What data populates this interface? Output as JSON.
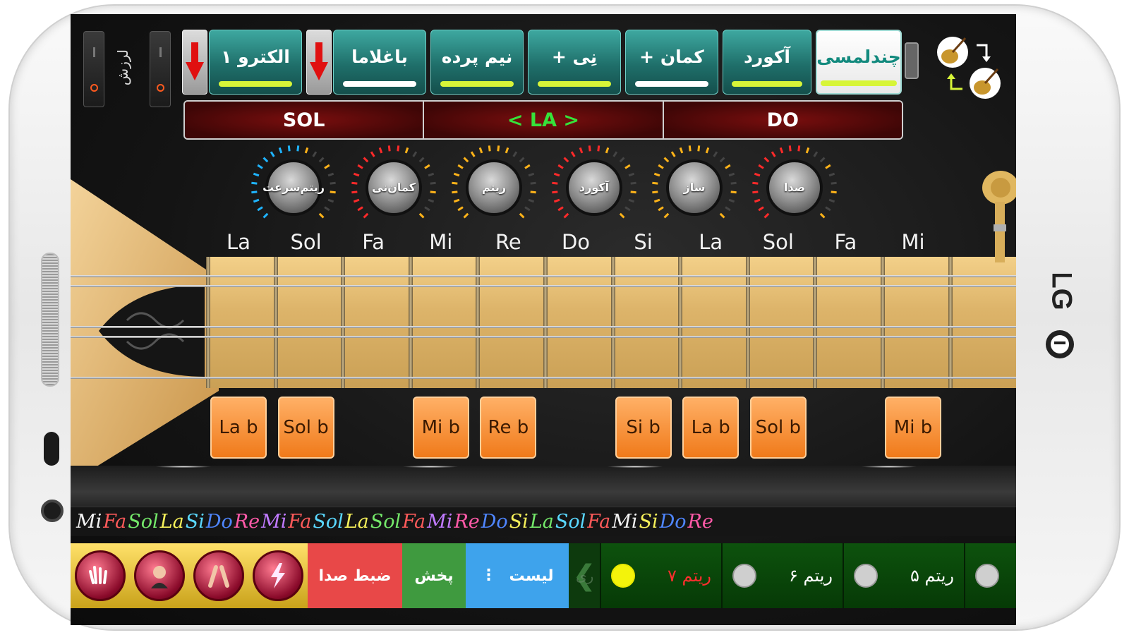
{
  "vibration_label": "لرزش",
  "tabs": [
    {
      "id": "electro",
      "label": "الکترو ۱",
      "bar": "#d7f538"
    },
    {
      "id": "baglama",
      "label": "باغلاما",
      "bar": "#ffffff"
    },
    {
      "id": "half-tone",
      "label": "نیم پرده",
      "bar": "#d7f538"
    },
    {
      "id": "ney",
      "label": "+ نِی",
      "bar": "#d7f538"
    },
    {
      "id": "kaman",
      "label": "+ کمان",
      "bar": "#ffffff"
    },
    {
      "id": "chord",
      "label": "آکورد",
      "bar": "#d7f538"
    },
    {
      "id": "multitouch",
      "label": "چندلمسی",
      "bar": "#d7f538",
      "active": true
    }
  ],
  "tuning": {
    "left": "SOL",
    "middle": "< LA >",
    "right": "DO"
  },
  "knobs": [
    {
      "line1": "سرعت",
      "line2": "ریتم",
      "ring": "#1fb4ff"
    },
    {
      "line1": "نی",
      "line2": "کمان",
      "ring": "#ff2a2a"
    },
    {
      "line1": "ریتم",
      "line2": "",
      "ring": "#ffb319"
    },
    {
      "line1": "آکورد",
      "line2": "",
      "ring": "#ff2a2a"
    },
    {
      "line1": "ساز",
      "line2": "",
      "ring": "#ffb319"
    },
    {
      "line1": "صدا",
      "line2": "",
      "ring": "#ff2a2a"
    }
  ],
  "note_labels": [
    "La",
    "Sol",
    "Fa",
    "Mi",
    "Re",
    "Do",
    "Si",
    "La",
    "Sol",
    "Fa",
    "Mi"
  ],
  "flat_buttons": [
    {
      "label": "La b",
      "slot": 0
    },
    {
      "label": "Sol b",
      "slot": 1
    },
    {
      "label": "Mi b",
      "slot": 3
    },
    {
      "label": "Re b",
      "slot": 4
    },
    {
      "label": "Si b",
      "slot": 6
    },
    {
      "label": "La b",
      "slot": 7
    },
    {
      "label": "Sol b",
      "slot": 8
    },
    {
      "label": "Mi b",
      "slot": 10
    }
  ],
  "scale_strip": [
    {
      "t": "Mi",
      "c": "#f2f2f2"
    },
    {
      "t": "Fa",
      "c": "#ff5a5a"
    },
    {
      "t": "Sol",
      "c": "#74e86a"
    },
    {
      "t": "La",
      "c": "#f6f05a"
    },
    {
      "t": "Si",
      "c": "#5ad8ff"
    },
    {
      "t": "Do",
      "c": "#4f86ff"
    },
    {
      "t": "Re",
      "c": "#ff5aa8"
    },
    {
      "t": "Mi",
      "c": "#c07aff"
    },
    {
      "t": "Fa",
      "c": "#ff5a5a"
    },
    {
      "t": "Sol",
      "c": "#5ad8ff"
    },
    {
      "t": "La",
      "c": "#f6f05a"
    },
    {
      "t": "Sol",
      "c": "#74e86a"
    },
    {
      "t": "Fa",
      "c": "#ff5a5a"
    },
    {
      "t": "Mi",
      "c": "#c07aff"
    },
    {
      "t": "Re",
      "c": "#ff5aa8"
    },
    {
      "t": "Do",
      "c": "#4f86ff"
    },
    {
      "t": "Si",
      "c": "#f6f05a"
    },
    {
      "t": "La",
      "c": "#74e86a"
    },
    {
      "t": "Sol",
      "c": "#5ad8ff"
    },
    {
      "t": "Fa",
      "c": "#ff5a5a"
    },
    {
      "t": "Mi",
      "c": "#f2f2f2"
    },
    {
      "t": "Si",
      "c": "#f6f05a"
    },
    {
      "t": "Do",
      "c": "#4f86ff"
    },
    {
      "t": "Re",
      "c": "#ff5aa8"
    }
  ],
  "bottom": {
    "record": "ضبط صدا",
    "play": "پخش",
    "list": "لیست",
    "rhythms": [
      {
        "label": "ریتم ۷",
        "on": true
      },
      {
        "label": "ریتم ۶",
        "on": false
      },
      {
        "label": "ریتم ۵",
        "on": false
      }
    ],
    "peek_label": "ری"
  }
}
